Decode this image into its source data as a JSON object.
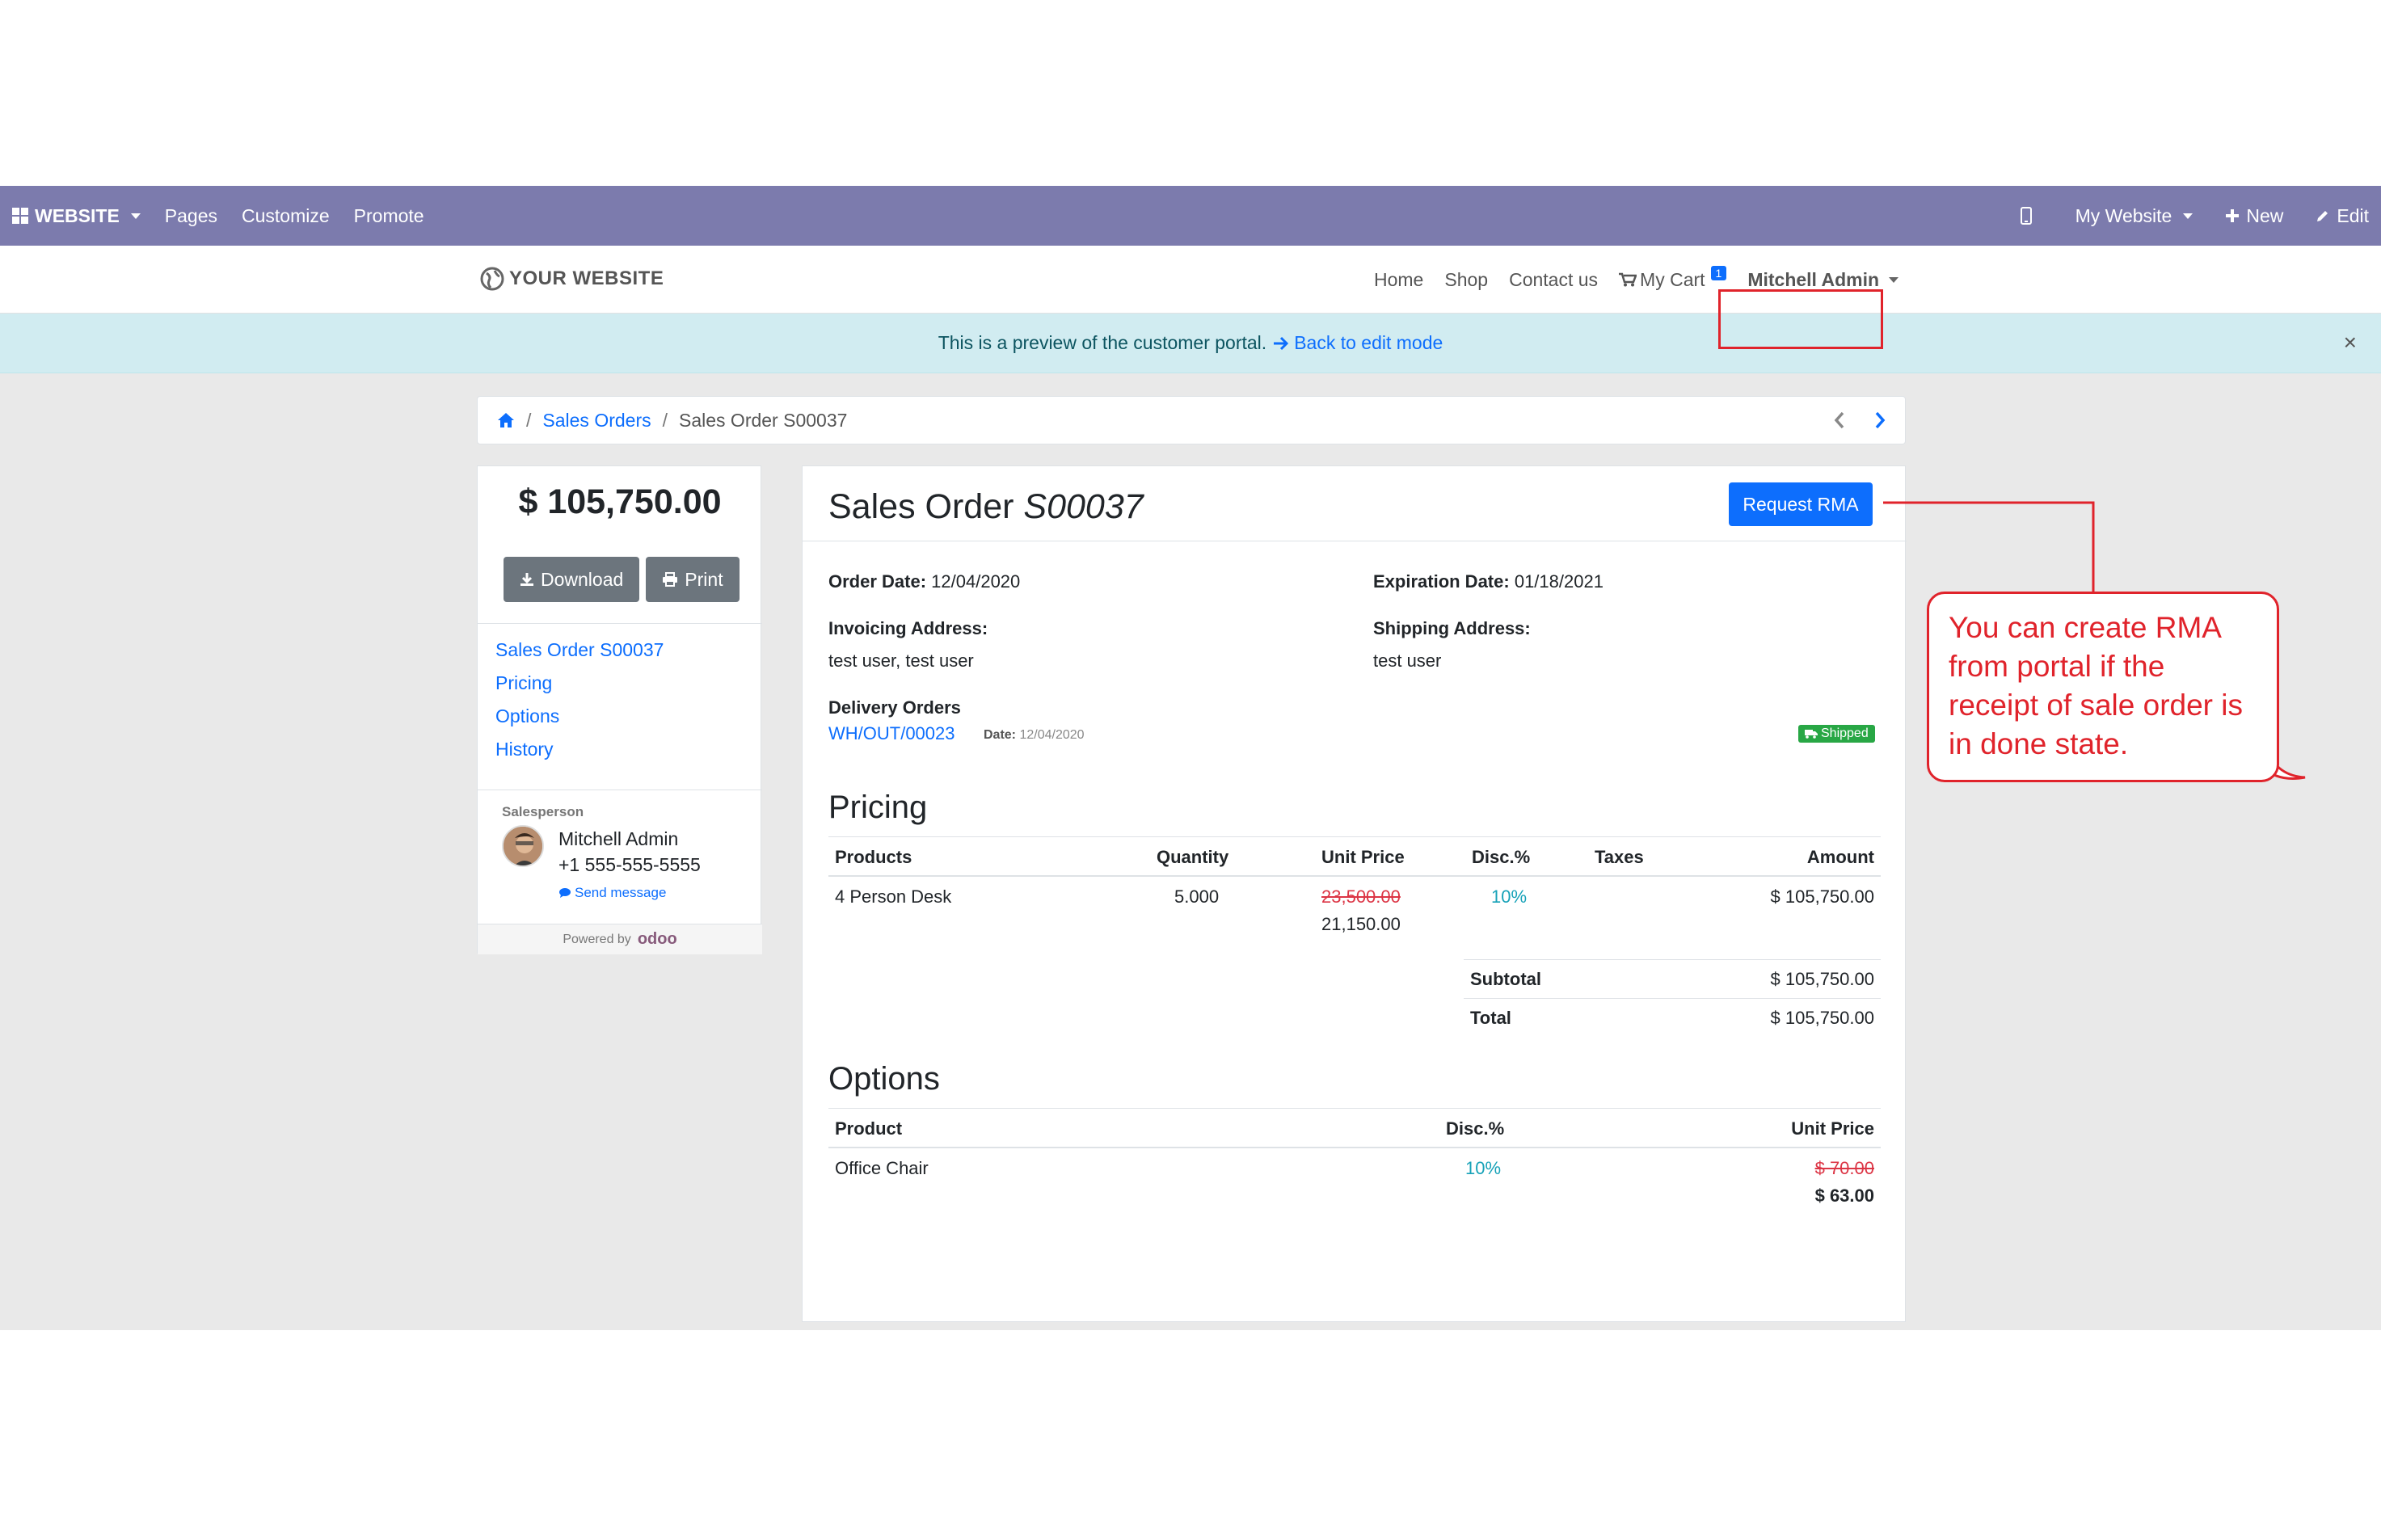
{
  "admin_bar": {
    "brand": "WEBSITE",
    "menu": [
      "Pages",
      "Customize",
      "Promote"
    ],
    "right": {
      "site": "My Website",
      "new": "New",
      "edit": "Edit"
    }
  },
  "site_nav": {
    "logo": "YOUR WEBSITE",
    "links": [
      "Home",
      "Shop",
      "Contact us"
    ],
    "cart": "My Cart",
    "cart_count": "1",
    "user": "Mitchell Admin"
  },
  "preview_banner": {
    "text": "This is a preview of the customer portal.",
    "link": "Back to edit mode",
    "close": "×"
  },
  "breadcrumb": {
    "sales_orders": "Sales Orders",
    "current": "Sales Order S00037"
  },
  "sidebar": {
    "amount": "$ 105,750.00",
    "download": "Download",
    "print": "Print",
    "nav": [
      "Sales Order S00037",
      "Pricing",
      "Options",
      "History"
    ],
    "salesperson_label": "Salesperson",
    "salesperson_name": "Mitchell Admin",
    "salesperson_phone": "+1 555-555-5555",
    "send_message": "Send message",
    "powered_by": "Powered by",
    "odoo": "odoo"
  },
  "order": {
    "title_prefix": "Sales Order",
    "title_ref": "S00037",
    "rma_button": "Request RMA",
    "order_date_label": "Order Date:",
    "order_date": "12/04/2020",
    "expiration_label": "Expiration Date:",
    "expiration_date": "01/18/2021",
    "invoicing_label": "Invoicing Address:",
    "invoicing_value": "test user, test user",
    "shipping_label": "Shipping Address:",
    "shipping_value": "test user",
    "delivery_label": "Delivery Orders",
    "delivery_ref": "WH/OUT/00023",
    "delivery_date_label": "Date:",
    "delivery_date": "12/04/2020",
    "delivery_status": "Shipped"
  },
  "pricing": {
    "title": "Pricing",
    "headers": [
      "Products",
      "Quantity",
      "Unit Price",
      "Disc.%",
      "Taxes",
      "Amount"
    ],
    "rows": [
      {
        "product": "4 Person Desk",
        "quantity": "5.000",
        "old_price": "23,500.00",
        "price": "21,150.00",
        "disc": "10%",
        "taxes": "",
        "amount": "$ 105,750.00"
      }
    ],
    "subtotal_label": "Subtotal",
    "subtotal": "$ 105,750.00",
    "total_label": "Total",
    "total": "$ 105,750.00"
  },
  "options": {
    "title": "Options",
    "headers": [
      "Product",
      "Disc.%",
      "Unit Price"
    ],
    "rows": [
      {
        "product": "Office Chair",
        "disc": "10%",
        "old_price": "$ 70.00",
        "price": "$ 63.00"
      }
    ]
  },
  "annotation": {
    "text": "You can create RMA from portal if the receipt of sale order is in done state.",
    "color": "#e0232b"
  },
  "colors": {
    "admin_bar": "#7c7bad",
    "primary": "#0d6efd",
    "success": "#28a745",
    "info_bg": "#d1ecf1"
  }
}
